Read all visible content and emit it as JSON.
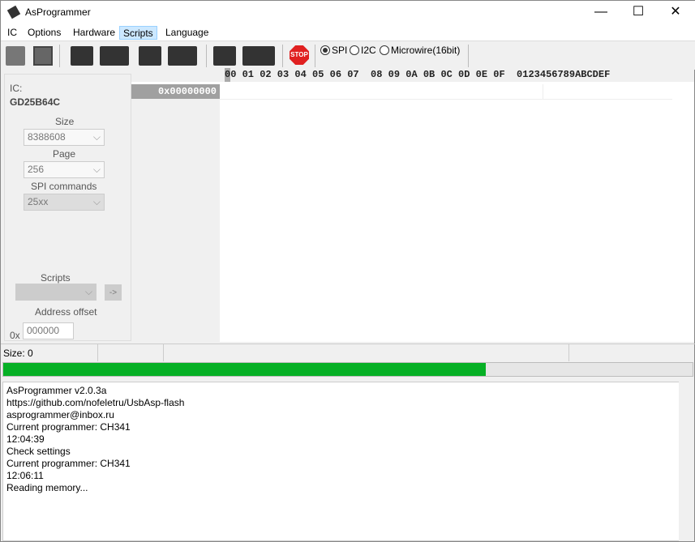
{
  "window": {
    "title": "AsProgrammer",
    "minimize": "—",
    "maximize": "☐",
    "close": "✕"
  },
  "menu": [
    "IC",
    "Options",
    "Hardware",
    "Scripts",
    "Language"
  ],
  "toolbar": {
    "stop_label": "STOP",
    "protocols": [
      {
        "label": "SPI",
        "selected": true
      },
      {
        "label": "I2C",
        "selected": false
      },
      {
        "label": "Microwire(16bit)",
        "selected": false
      }
    ]
  },
  "hex": {
    "header": "00 01 02 03 04 05 06 07  08 09 0A 0B 0C 0D 0E 0F  0123456789ABCDEF",
    "address": "0x00000000"
  },
  "ic": {
    "label": "IC:",
    "name": "GD25B64C",
    "size_label": "Size",
    "size": "8388608",
    "page_label": "Page",
    "page": "256",
    "spi_label": "SPI commands",
    "spi": "25xx",
    "scripts_label": "Scripts",
    "scripts": "",
    "run_button": "->",
    "offset_label": "Address offset",
    "offset_prefix": "0x",
    "offset": "000000"
  },
  "status": {
    "size": "Size: 0"
  },
  "progress": {
    "percent": 70,
    "color": "#06b025"
  },
  "log": [
    "AsProgrammer v2.0.3a",
    "https://github.com/nofeletru/UsbAsp-flash",
    "asprogrammer@inbox.ru",
    "Current programmer: CH341",
    "12:04:39",
    "Check settings",
    "Current programmer: CH341",
    "12:06:11",
    "Reading memory..."
  ]
}
